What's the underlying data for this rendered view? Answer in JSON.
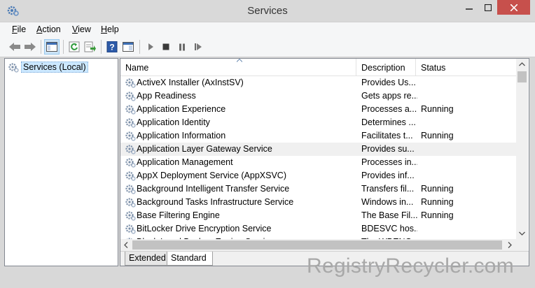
{
  "window": {
    "title": "Services",
    "controls": {
      "minimize": "–",
      "maximize": "□",
      "close": "✕"
    }
  },
  "menu": {
    "items": [
      {
        "label": "File",
        "accel": "F",
        "rest": "ile"
      },
      {
        "label": "Action",
        "accel": "A",
        "rest": "ction"
      },
      {
        "label": "View",
        "accel": "V",
        "rest": "iew"
      },
      {
        "label": "Help",
        "accel": "H",
        "rest": "elp"
      }
    ]
  },
  "toolbar": {
    "icons": [
      "back-icon",
      "forward-icon",
      "show-hide-console-tree-icon",
      "refresh-icon",
      "export-list-icon",
      "help-icon",
      "properties-icon",
      "play-icon",
      "stop-icon",
      "pause-icon",
      "restart-icon"
    ]
  },
  "tree": {
    "root_label": "Services (Local)"
  },
  "columns": {
    "name": "Name",
    "description": "Description",
    "status": "Status"
  },
  "services": [
    {
      "name": "ActiveX Installer (AxInstSV)",
      "description": "Provides Us...",
      "status": ""
    },
    {
      "name": "App Readiness",
      "description": "Gets apps re...",
      "status": ""
    },
    {
      "name": "Application Experience",
      "description": "Processes a...",
      "status": "Running"
    },
    {
      "name": "Application Identity",
      "description": "Determines ...",
      "status": ""
    },
    {
      "name": "Application Information",
      "description": "Facilitates t...",
      "status": "Running"
    },
    {
      "name": "Application Layer Gateway Service",
      "description": "Provides su...",
      "status": ""
    },
    {
      "name": "Application Management",
      "description": "Processes in...",
      "status": ""
    },
    {
      "name": "AppX Deployment Service (AppXSVC)",
      "description": "Provides inf...",
      "status": ""
    },
    {
      "name": "Background Intelligent Transfer Service",
      "description": "Transfers fil...",
      "status": "Running"
    },
    {
      "name": "Background Tasks Infrastructure Service",
      "description": "Windows in...",
      "status": "Running"
    },
    {
      "name": "Base Filtering Engine",
      "description": "The Base Fil...",
      "status": "Running"
    },
    {
      "name": "BitLocker Drive Encryption Service",
      "description": "BDESVC hos...",
      "status": ""
    },
    {
      "name": "Block Level Backup Engine Service",
      "description": "The WBENG...",
      "status": ""
    }
  ],
  "highlighted_row": 5,
  "tabs": {
    "extended": "Extended",
    "standard": "Standard",
    "active": "Standard"
  },
  "watermark": "RegistryRecycler.com",
  "colors": {
    "close_button": "#c7504c",
    "selection": "#cce8ff",
    "row_hover": "#f0f0f0"
  }
}
